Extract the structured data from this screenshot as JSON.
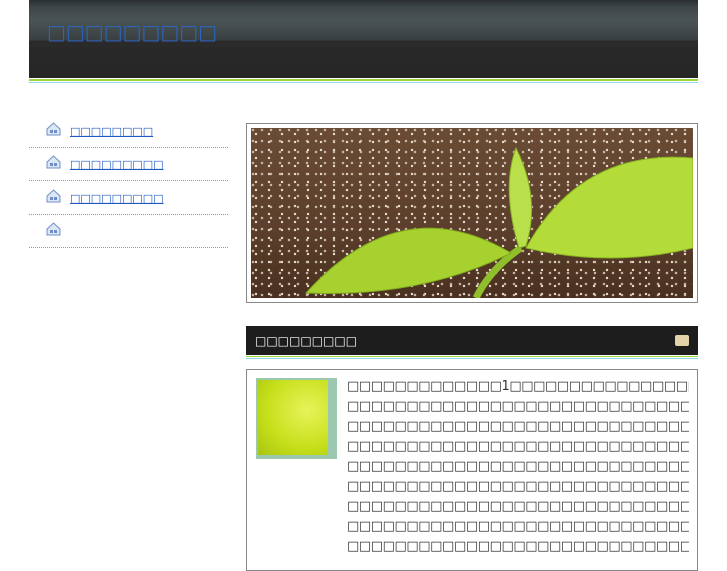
{
  "header": {
    "title": "□□□□□□□□□"
  },
  "sidebar": {
    "items": [
      {
        "label": "□□□□□□□□"
      },
      {
        "label": "□□□□□□□□□"
      },
      {
        "label": "□□□□□□□□□"
      },
      {
        "label": ""
      }
    ]
  },
  "section": {
    "title": "□□□□□□□□□"
  },
  "content": {
    "lines": [
      "□□□□□□□□□□□□□1□□□□□□□□□□□□□□□□□□□□□□",
      "□□□□□□□□□□□□□□□□□□□□□□□□□□□□□□□□□□□",
      "□□□□□□□□□□□□□□□□□□□□□□□□□□□□□□□□□",
      "□□□□□□□□□□□□□□□□□□□□□□□□□□□□□□□□□□□",
      "□□□□□□□□□□□□□□□□□□□□□□□□□□□□□□□□□□□",
      "□□□□□□□□□□□□□□□□□□□□□□□□□□□□□□□□□□□",
      "□□□□□□□□□□□□□□□□□□□□□□□□□□□□□□□□□□□",
      "□□□□□□□□□□□□□□□□□□□□□□□□□□□□□□□□□□□",
      "□□□□□□□□□□□□□□□□□□□□□□□□□□□□□□□□□□□"
    ]
  }
}
